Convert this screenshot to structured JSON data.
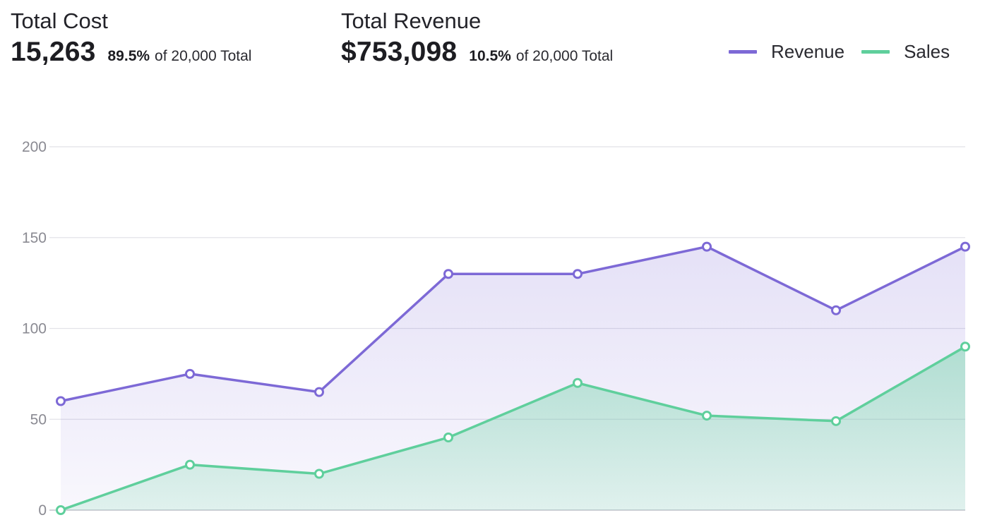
{
  "stats": {
    "cost": {
      "title": "Total Cost",
      "value": "15,263",
      "percent": "89.5%",
      "suffix": "of 20,000 Total"
    },
    "revenue": {
      "title": "Total Revenue",
      "value": "$753,098",
      "percent": "10.5%",
      "suffix": "of 20,000 Total"
    }
  },
  "legend": [
    {
      "label": "Revenue",
      "color": "#7d69d6"
    },
    {
      "label": "Sales",
      "color": "#5fcf9c"
    }
  ],
  "chart_data": {
    "type": "area",
    "title": "",
    "xlabel": "",
    "ylabel": "",
    "x": [
      1,
      2,
      3,
      4,
      5,
      6,
      7,
      8
    ],
    "ylim": [
      0,
      200
    ],
    "yticks": [
      0,
      50,
      100,
      150,
      200
    ],
    "grid": true,
    "legend_position": "top-right",
    "series": [
      {
        "name": "Revenue",
        "color": "#7d69d6",
        "values": [
          60,
          75,
          65,
          130,
          130,
          145,
          110,
          145
        ]
      },
      {
        "name": "Sales",
        "color": "#5fcf9c",
        "values": [
          0,
          25,
          20,
          40,
          70,
          52,
          49,
          90
        ]
      }
    ]
  }
}
